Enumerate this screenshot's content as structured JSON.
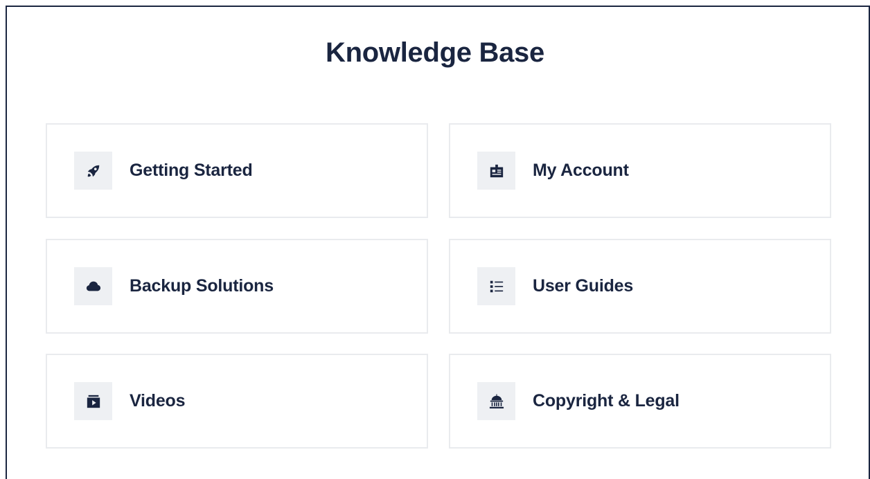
{
  "page": {
    "title": "Knowledge Base"
  },
  "colors": {
    "text": "#1a2540",
    "card_border": "#e9ebee",
    "icon_bg": "#eef0f3",
    "frame_border": "#1a2540"
  },
  "categories": [
    {
      "label": "Getting Started",
      "icon": "rocket-icon"
    },
    {
      "label": "My Account",
      "icon": "id-badge-icon"
    },
    {
      "label": "Backup Solutions",
      "icon": "cloud-icon"
    },
    {
      "label": "User Guides",
      "icon": "list-icon"
    },
    {
      "label": "Videos",
      "icon": "video-icon"
    },
    {
      "label": "Copyright & Legal",
      "icon": "courthouse-icon"
    }
  ]
}
